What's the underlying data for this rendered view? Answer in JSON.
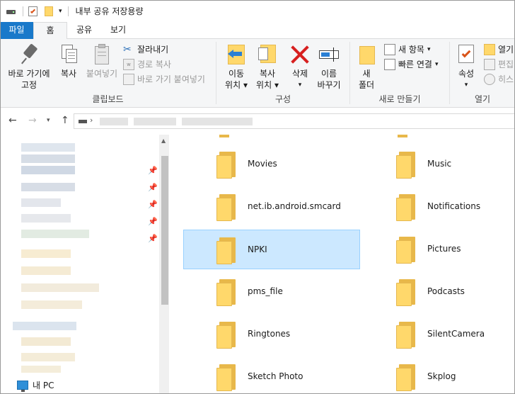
{
  "window": {
    "title": "내부 공유 저장용량"
  },
  "tabs": {
    "file": "파일",
    "home": "홈",
    "share": "공유",
    "view": "보기"
  },
  "ribbon": {
    "clipboard": {
      "pin": "바로 가기에\n고정",
      "copy": "복사",
      "paste": "붙여넣기",
      "cut": "잘라내기",
      "copy_path": "경로 복사",
      "paste_shortcut": "바로 가기 붙여넣기",
      "label": "클립보드"
    },
    "organize": {
      "move_to": "이동\n위치",
      "copy_to": "복사\n위치",
      "delete": "삭제",
      "rename": "이름\n바꾸기",
      "label": "구성"
    },
    "new": {
      "new_folder": "새\n폴더",
      "new_item": "새 항목",
      "easy_access": "빠른 연결",
      "label": "새로 만들기"
    },
    "open": {
      "properties": "속성",
      "open": "열기",
      "edit": "편집",
      "history": "히스",
      "label": "열기"
    }
  },
  "nav": {
    "this_pc": "내 PC"
  },
  "files": {
    "left": [
      "Movies",
      "net.ib.android.smcard",
      "NPKI",
      "pms_file",
      "Ringtones",
      "Sketch Photo"
    ],
    "right": [
      "Music",
      "Notifications",
      "Pictures",
      "Podcasts",
      "SilentCamera",
      "Skplog"
    ]
  },
  "colors": {
    "accent": "#1979ca",
    "selection": "#cce8ff",
    "folder": "#ffd86b"
  }
}
